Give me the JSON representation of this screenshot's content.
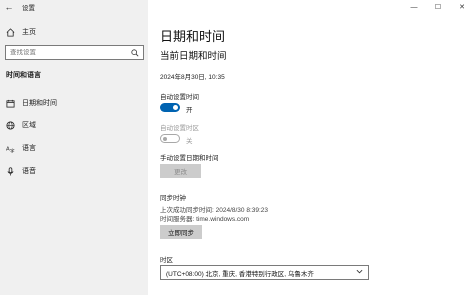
{
  "window": {
    "title": "设置",
    "controls": {
      "minimize": "—",
      "maximize": "☐",
      "close": "✕"
    }
  },
  "nav": {
    "back_icon": "←",
    "home_label": "主页",
    "search_placeholder": "查找设置",
    "section_title": "时间和语言",
    "items": [
      {
        "label": "日期和时间",
        "icon": "calendar-icon"
      },
      {
        "label": "区域",
        "icon": "globe-icon"
      },
      {
        "label": "语言",
        "icon": "language-icon"
      },
      {
        "label": "语音",
        "icon": "microphone-icon"
      }
    ]
  },
  "main": {
    "page_title": "日期和时间",
    "subtitle": "当前日期和时间",
    "current_datetime": "2024年8月30日, 10:35",
    "auto_time": {
      "label": "自动设置时间",
      "state_text": "开",
      "on": true
    },
    "auto_timezone": {
      "label": "自动设置时区",
      "state_text": "关",
      "on": false
    },
    "manual": {
      "label": "手动设置日期和时间",
      "button": "更改"
    },
    "sync": {
      "label": "同步时钟",
      "last_sync": "上次成功同步时间: 2024/8/30 8:39:23",
      "server": "时间服务器: time.windows.com",
      "button": "立即同步"
    },
    "timezone": {
      "label": "时区",
      "value": "(UTC+08:00) 北京, 重庆, 香港特别行政区, 乌鲁木齐"
    }
  },
  "colors": {
    "accent": "#0063b1",
    "nav_bg": "#f0f0f0",
    "button_bg": "#cccccc"
  }
}
